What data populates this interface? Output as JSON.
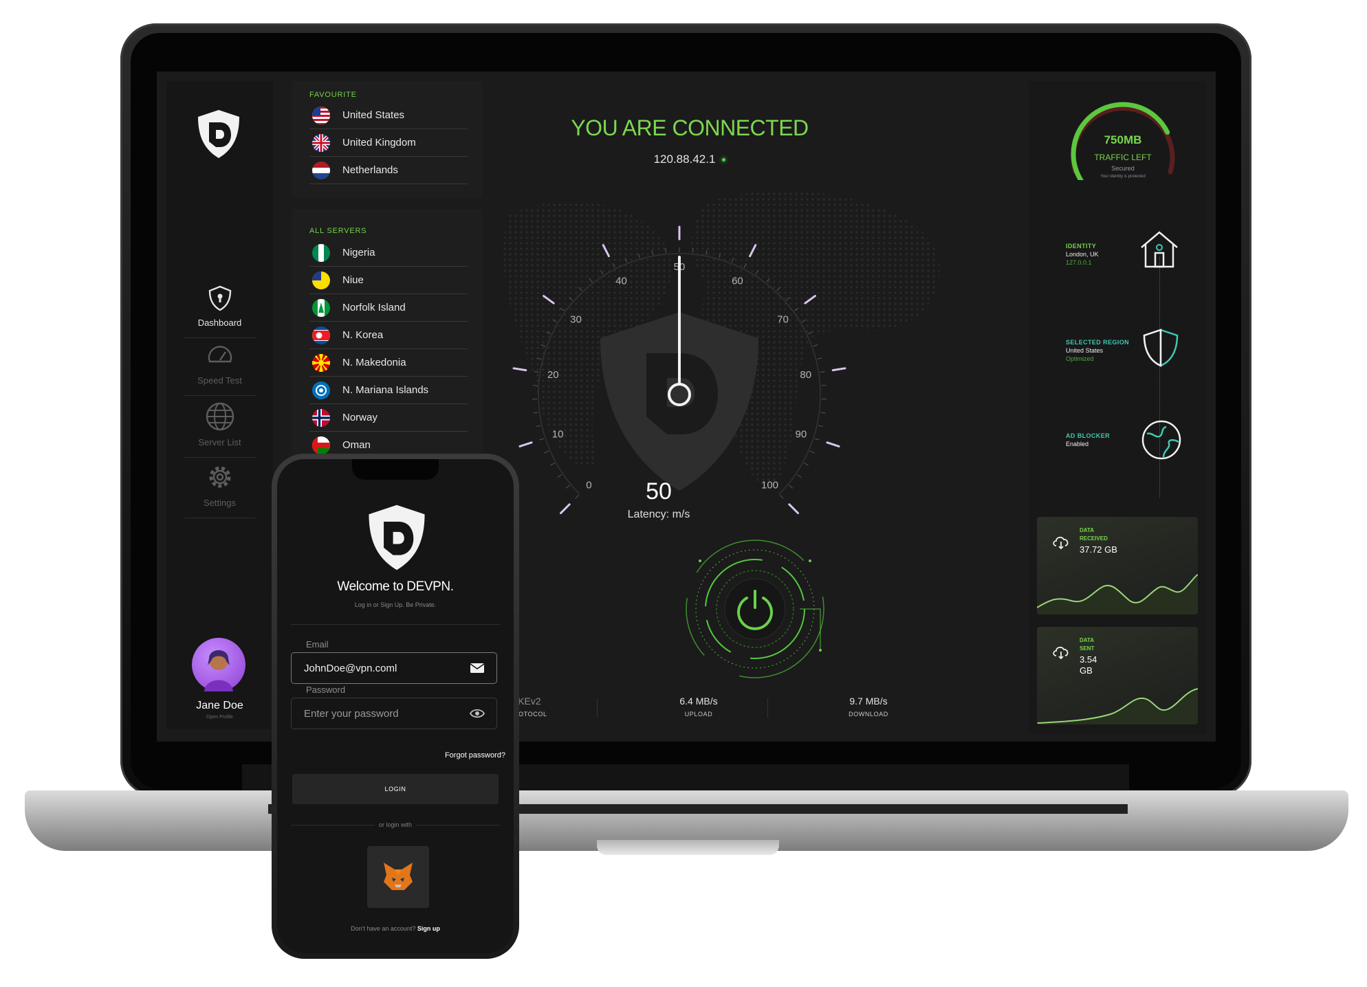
{
  "sidebar": {
    "nav": [
      {
        "label": "Dashboard",
        "icon": "shield-keyhole-icon",
        "active": true
      },
      {
        "label": "Speed Test",
        "icon": "speedometer-icon",
        "active": false
      },
      {
        "label": "Server List",
        "icon": "globe-icon",
        "active": false
      },
      {
        "label": "Settings",
        "icon": "gear-icon",
        "active": false
      }
    ],
    "user": {
      "name": "Jane Doe",
      "profile_link": "Open Profile"
    }
  },
  "favourite": {
    "title": "FAVOURITE",
    "servers": [
      {
        "name": "United States",
        "flag": "flag-us"
      },
      {
        "name": "United Kingdom",
        "flag": "flag-uk"
      },
      {
        "name": "Netherlands",
        "flag": "flag-nl"
      }
    ]
  },
  "all_servers": {
    "title": "ALL SERVERS",
    "servers": [
      {
        "name": "Nigeria",
        "flag": "flag-ng"
      },
      {
        "name": "Niue",
        "flag": "flag-nu"
      },
      {
        "name": "Norfolk Island",
        "flag": "flag-nf"
      },
      {
        "name": "N. Korea",
        "flag": "flag-kp"
      },
      {
        "name": "N. Makedonia",
        "flag": "flag-mk"
      },
      {
        "name": "N. Mariana Islands",
        "flag": "flag-mp"
      },
      {
        "name": "Norway",
        "flag": "flag-no"
      },
      {
        "name": "Oman",
        "flag": "flag-om"
      }
    ]
  },
  "connection": {
    "status": "YOU ARE CONNECTED",
    "ip": "120.88.42.1",
    "gauge": {
      "min": 0,
      "max": 100,
      "ticks": [
        "0",
        "10",
        "20",
        "30",
        "40",
        "50",
        "60",
        "70",
        "80",
        "90",
        "100"
      ],
      "value": 50
    },
    "speed_value": "50",
    "latency_label": "Latency: m/s"
  },
  "stats": [
    {
      "value": "IKEv2",
      "label": "PROTOCOL"
    },
    {
      "value": "6.4 MB/s",
      "label": "UPLOAD"
    },
    {
      "value": "9.7 MB/s",
      "label": "DOWNLOAD"
    }
  ],
  "traffic": {
    "value": "750MB",
    "label": "TRAFFIC LEFT",
    "status": "Secured",
    "note": "Your identity is protected",
    "remaining_fraction": 0.75
  },
  "identity": {
    "title": "IDENTITY",
    "location": "London, UK",
    "ip": "127.0.0.1"
  },
  "selected_region": {
    "title": "SELECTED REGION",
    "region": "United States",
    "status": "Optimized"
  },
  "ad_blocker": {
    "title": "AD BLOCKER",
    "status": "Enabled"
  },
  "data_received": {
    "label_1": "DATA",
    "label_2": "RECEIVED",
    "value": "37.72 GB"
  },
  "data_sent": {
    "label_1": "DATA",
    "label_2": "SENT",
    "value_1": "3.54",
    "value_2": "GB"
  },
  "colors": {
    "accent": "#7cd84f",
    "teal": "#3fc9b4",
    "bg": "#1b1b1b"
  },
  "mobile": {
    "title": "Welcome to DEVPN.",
    "subtitle": "Log in or Sign Up. Be Private.",
    "email_label": "Email",
    "email_value": "JohnDoe@vpn.coml",
    "password_label": "Password",
    "password_placeholder": "Enter your password",
    "forgot": "Forgot password?",
    "login": "LOGIN",
    "or_login_with": "or login with",
    "no_account": "Don't have an account?",
    "signup": "Sign up"
  }
}
